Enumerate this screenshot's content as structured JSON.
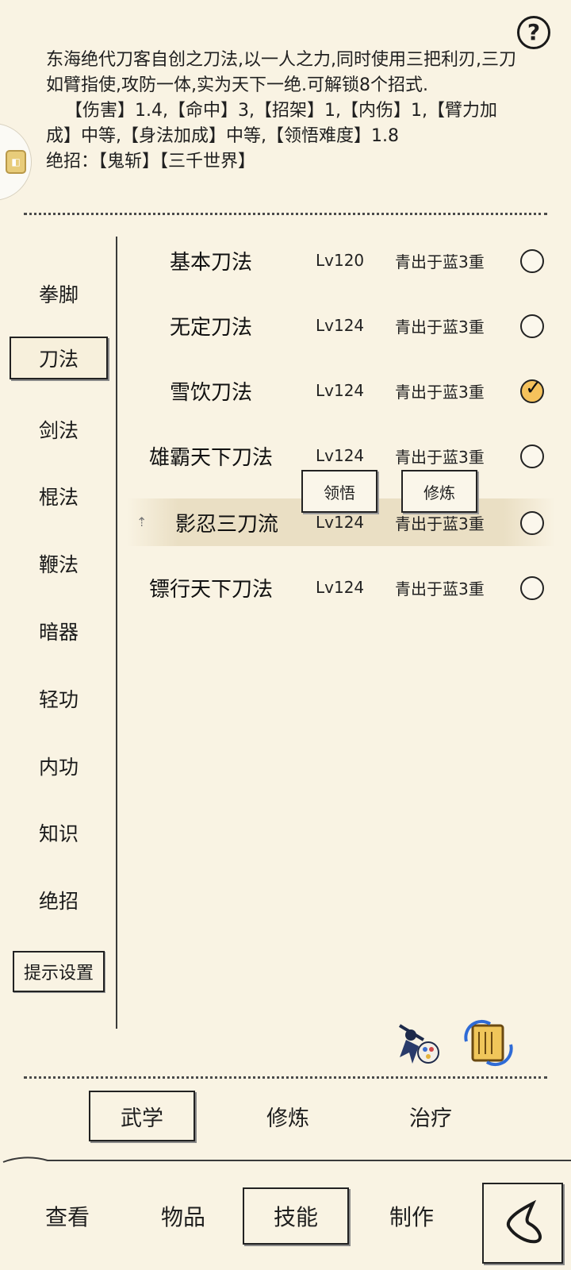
{
  "help_icon": "question-mark-icon",
  "description": {
    "intro": "东海绝代刀客自创之刀法,以一人之力,同时使用三把利刃,三刀如臂指使,攻防一体,实为天下一绝.可解锁8个招式.",
    "stats": "【伤害】1.4,【命中】3,【招架】1,【内伤】1,【臂力加成】中等,【身法加成】中等,【领悟难度】1.8",
    "ultimate_label": "绝招：",
    "ultimate_moves": "【鬼斩】【三千世界】"
  },
  "categories": [
    {
      "label": "拳脚"
    },
    {
      "label": "刀法",
      "selected": true
    },
    {
      "label": "剑法"
    },
    {
      "label": "棍法"
    },
    {
      "label": "鞭法"
    },
    {
      "label": "暗器"
    },
    {
      "label": "轻功"
    },
    {
      "label": "内功"
    },
    {
      "label": "知识"
    },
    {
      "label": "绝招"
    }
  ],
  "hint_settings_label": "提示设置",
  "skills": [
    {
      "name": "基本刀法",
      "level": "Lv120",
      "rank": "青出于蓝3重",
      "checked": false
    },
    {
      "name": "无定刀法",
      "level": "Lv124",
      "rank": "青出于蓝3重",
      "checked": false
    },
    {
      "name": "雪饮刀法",
      "level": "Lv124",
      "rank": "青出于蓝3重",
      "checked": true
    },
    {
      "name": "雄霸天下刀法",
      "level": "Lv124",
      "rank": "青出于蓝3重",
      "checked": false
    },
    {
      "name": "影忍三刀流",
      "level": "Lv124",
      "rank": "青出于蓝3重",
      "checked": false
    },
    {
      "name": "镖行天下刀法",
      "level": "Lv124",
      "rank": "青出于蓝3重",
      "checked": false
    }
  ],
  "popup": {
    "comprehend_label": "领悟",
    "train_label": "修炼"
  },
  "tool_icons": [
    "swordsman-palette-icon",
    "scroll-swap-icon"
  ],
  "subtabs": [
    {
      "label": "武学",
      "selected": true
    },
    {
      "label": "修炼"
    },
    {
      "label": "治疗"
    }
  ],
  "nav": [
    {
      "label": "查看"
    },
    {
      "label": "物品"
    },
    {
      "label": "技能",
      "selected": true
    },
    {
      "label": "制作"
    }
  ],
  "back_icon": "back-chevron-icon"
}
